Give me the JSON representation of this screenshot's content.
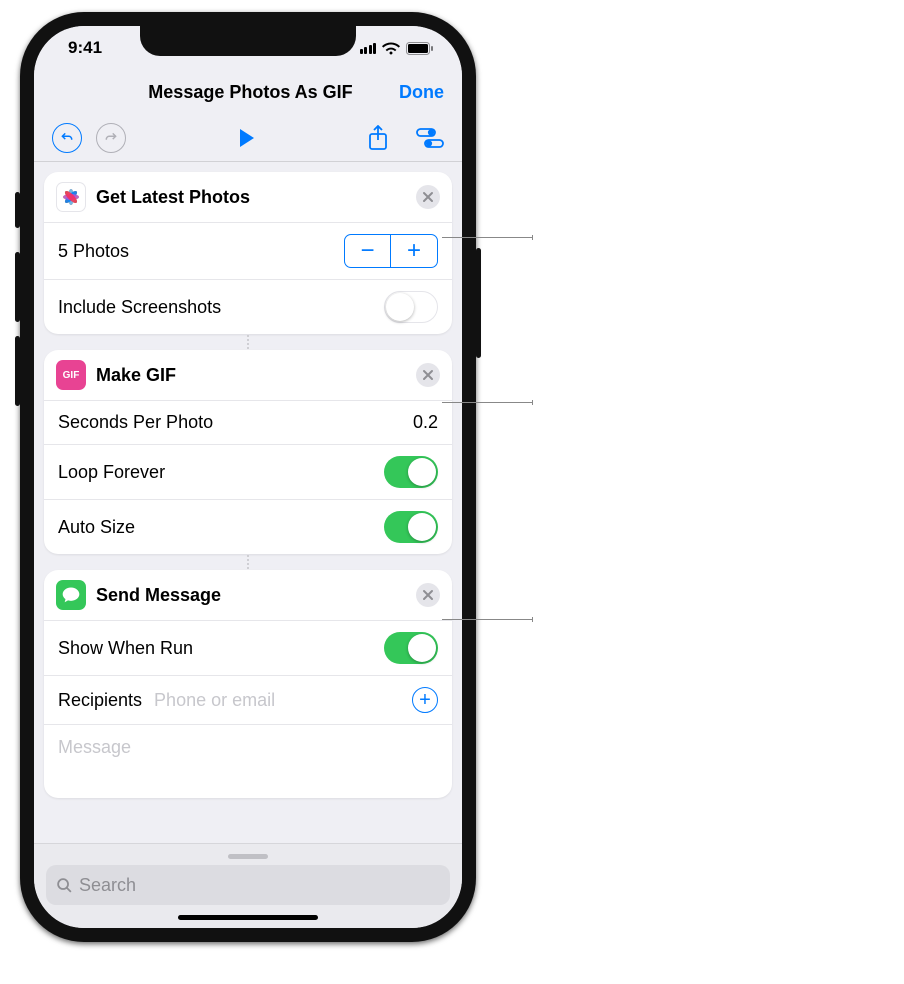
{
  "status": {
    "time": "9:41"
  },
  "nav": {
    "title": "Message Photos As GIF",
    "done": "Done"
  },
  "actions": [
    {
      "title": "Get Latest Photos",
      "photo_count": "5 Photos",
      "include_screenshots_label": "Include Screenshots"
    },
    {
      "title": "Make GIF",
      "seconds_label": "Seconds Per Photo",
      "seconds_value": "0.2",
      "loop_label": "Loop Forever",
      "autosize_label": "Auto Size"
    },
    {
      "title": "Send Message",
      "show_when_run_label": "Show When Run",
      "recipients_label": "Recipients",
      "recipients_placeholder": "Phone or email",
      "message_placeholder": "Message"
    }
  ],
  "search": {
    "placeholder": "Search"
  }
}
